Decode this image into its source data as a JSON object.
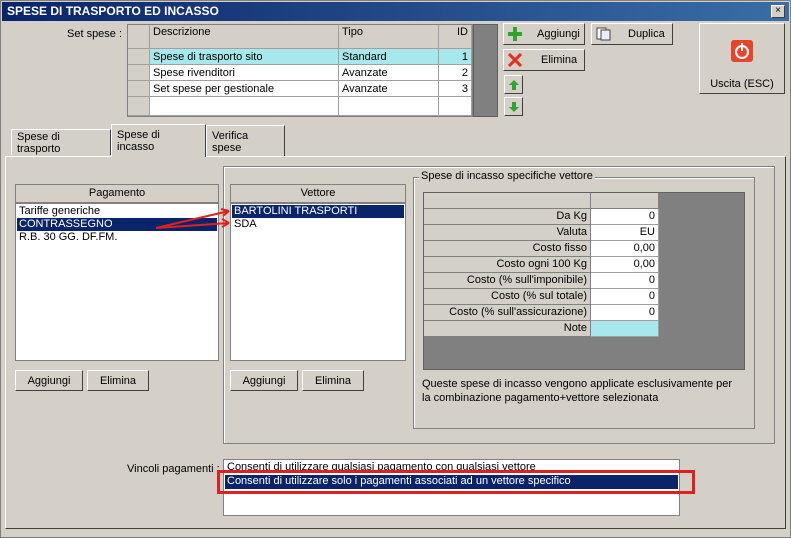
{
  "window": {
    "title": "SPESE DI TRASPORTO ED INCASSO",
    "close_glyph": "×"
  },
  "set_spese": {
    "label": "Set spese :",
    "columns": [
      "Descrizione",
      "Tipo",
      "ID"
    ],
    "rows": [
      {
        "descrizione": "Spese di trasporto sito",
        "tipo": "Standard",
        "id": "1"
      },
      {
        "descrizione": "Spese rivenditori",
        "tipo": "Avanzate",
        "id": "2"
      },
      {
        "descrizione": "Set spese per gestionale",
        "tipo": "Avanzate",
        "id": "3"
      }
    ]
  },
  "toolbar": {
    "aggiungi": "Aggiungi",
    "duplica": "Duplica",
    "elimina": "Elimina",
    "uscita": "Uscita (ESC)"
  },
  "tabs": [
    "Spese di trasporto",
    "Spese di incasso",
    "Verifica spese"
  ],
  "pagamento": {
    "header": "Pagamento",
    "items": [
      "Tariffe generiche",
      "CONTRASSEGNO",
      "R.B. 30 GG. DF.FM."
    ],
    "aggiungi": "Aggiungi",
    "elimina": "Elimina"
  },
  "vettore": {
    "header": "Vettore",
    "items": [
      "BARTOLINI TRASPORTI",
      "SDA"
    ],
    "aggiungi": "Aggiungi",
    "elimina": "Elimina"
  },
  "specifiche": {
    "title": "Spese di incasso specifiche vettore",
    "rows": [
      {
        "label": "Da Kg",
        "value": "0"
      },
      {
        "label": "Valuta",
        "value": "EU"
      },
      {
        "label": "Costo fisso",
        "value": "0,00"
      },
      {
        "label": "Costo ogni 100 Kg",
        "value": "0,00"
      },
      {
        "label": "Costo (% sull'imponibile)",
        "value": "0"
      },
      {
        "label": "Costo (% sul totale)",
        "value": "0"
      },
      {
        "label": "Costo (% sull'assicurazione)",
        "value": "0"
      },
      {
        "label": "Note",
        "value": ""
      }
    ],
    "note_line1": "Queste spese di incasso vengono applicate esclusivamente per",
    "note_line2": "la combinazione pagamento+vettore selezionata"
  },
  "vincoli": {
    "label": "Vincoli pagamenti :",
    "options": [
      "Consenti di utilizzare qualsiasi pagamento con qualsiasi vettore",
      "Consenti di utilizzare solo i pagamenti associati ad un vettore specifico"
    ]
  },
  "colors": {
    "title_bar": "#0a246a",
    "selected_row": "#a6e8ec",
    "active_item": "#0a246a",
    "annotation": "#e02020"
  }
}
